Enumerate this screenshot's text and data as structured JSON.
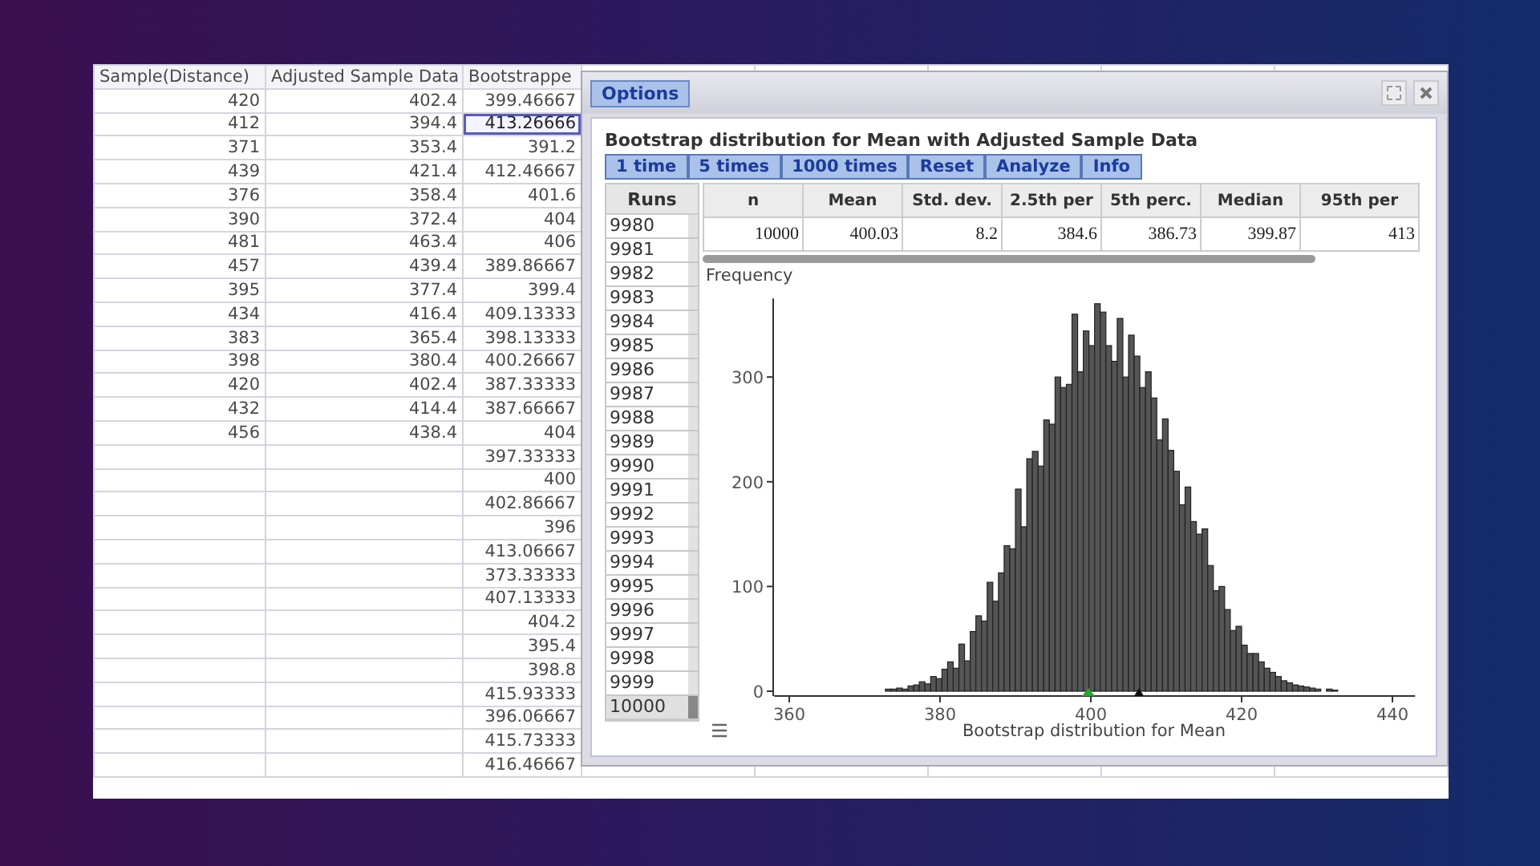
{
  "sheet": {
    "columns": [
      "Sample(Distance)",
      "Adjusted Sample Data",
      "Bootstrappe"
    ],
    "rows": [
      {
        "sample": "420",
        "adjusted": "402.4",
        "bootstrapped": "399.46667",
        "selected": false
      },
      {
        "sample": "412",
        "adjusted": "394.4",
        "bootstrapped": "413.26666",
        "selected": true
      },
      {
        "sample": "371",
        "adjusted": "353.4",
        "bootstrapped": "391.2",
        "selected": false
      },
      {
        "sample": "439",
        "adjusted": "421.4",
        "bootstrapped": "412.46667",
        "selected": false
      },
      {
        "sample": "376",
        "adjusted": "358.4",
        "bootstrapped": "401.6",
        "selected": false
      },
      {
        "sample": "390",
        "adjusted": "372.4",
        "bootstrapped": "404",
        "selected": false
      },
      {
        "sample": "481",
        "adjusted": "463.4",
        "bootstrapped": "406",
        "selected": false
      },
      {
        "sample": "457",
        "adjusted": "439.4",
        "bootstrapped": "389.86667",
        "selected": false
      },
      {
        "sample": "395",
        "adjusted": "377.4",
        "bootstrapped": "399.4",
        "selected": false
      },
      {
        "sample": "434",
        "adjusted": "416.4",
        "bootstrapped": "409.13333",
        "selected": false
      },
      {
        "sample": "383",
        "adjusted": "365.4",
        "bootstrapped": "398.13333",
        "selected": false
      },
      {
        "sample": "398",
        "adjusted": "380.4",
        "bootstrapped": "400.26667",
        "selected": false
      },
      {
        "sample": "420",
        "adjusted": "402.4",
        "bootstrapped": "387.33333",
        "selected": false
      },
      {
        "sample": "432",
        "adjusted": "414.4",
        "bootstrapped": "387.66667",
        "selected": false
      },
      {
        "sample": "456",
        "adjusted": "438.4",
        "bootstrapped": "404",
        "selected": false
      },
      {
        "bootstrapped": "397.33333",
        "selected": false
      },
      {
        "bootstrapped": "400",
        "selected": false
      },
      {
        "bootstrapped": "402.86667",
        "selected": false
      },
      {
        "bootstrapped": "396",
        "selected": false
      },
      {
        "bootstrapped": "413.06667",
        "selected": false
      },
      {
        "bootstrapped": "373.33333",
        "selected": false
      },
      {
        "bootstrapped": "407.13333",
        "selected": false
      },
      {
        "bootstrapped": "404.2",
        "selected": false
      },
      {
        "bootstrapped": "395.4",
        "selected": false
      },
      {
        "bootstrapped": "398.8",
        "selected": false
      },
      {
        "bootstrapped": "415.93333",
        "selected": false
      },
      {
        "bootstrapped": "396.06667",
        "selected": false
      },
      {
        "bootstrapped": "415.73333",
        "selected": false
      },
      {
        "bootstrapped": "416.46667",
        "selected": false
      }
    ]
  },
  "dialog": {
    "options_button": "Options",
    "title": "Bootstrap distribution for Mean with Adjusted Sample Data",
    "buttons": [
      "1 time",
      "5 times",
      "1000 times",
      "Reset",
      "Analyze",
      "Info"
    ],
    "runs": {
      "header": "Runs",
      "rows": [
        {
          "label": "9980",
          "selected": false
        },
        {
          "label": "9981",
          "selected": false
        },
        {
          "label": "9982",
          "selected": false
        },
        {
          "label": "9983",
          "selected": false
        },
        {
          "label": "9984",
          "selected": false
        },
        {
          "label": "9985",
          "selected": false
        },
        {
          "label": "9986",
          "selected": false
        },
        {
          "label": "9987",
          "selected": false
        },
        {
          "label": "9988",
          "selected": false
        },
        {
          "label": "9989",
          "selected": false
        },
        {
          "label": "9990",
          "selected": false
        },
        {
          "label": "9991",
          "selected": false
        },
        {
          "label": "9992",
          "selected": false
        },
        {
          "label": "9993",
          "selected": false
        },
        {
          "label": "9994",
          "selected": false
        },
        {
          "label": "9995",
          "selected": false
        },
        {
          "label": "9996",
          "selected": false
        },
        {
          "label": "9997",
          "selected": false
        },
        {
          "label": "9998",
          "selected": false
        },
        {
          "label": "9999",
          "selected": false
        },
        {
          "label": "10000",
          "selected": true
        }
      ]
    },
    "stats": {
      "columns": [
        "n",
        "Mean",
        "Std. dev.",
        "2.5th per",
        "5th perc.",
        "Median",
        "95th per"
      ],
      "values": [
        "10000",
        "400.03",
        "8.2",
        "384.6",
        "386.73",
        "399.87",
        "413"
      ]
    },
    "chart_data": {
      "type": "bar",
      "xlabel": "Bootstrap distribution for Mean",
      "ylabel": "Frequency",
      "x": [
        373.125,
        373.875,
        374.625,
        375.375,
        376.125,
        376.875,
        377.625,
        378.375,
        379.125,
        379.875,
        380.625,
        381.375,
        382.125,
        382.875,
        383.625,
        384.375,
        385.125,
        385.875,
        386.625,
        387.375,
        388.125,
        388.875,
        389.625,
        390.375,
        391.125,
        391.875,
        392.625,
        393.375,
        394.125,
        394.875,
        395.625,
        396.375,
        397.125,
        397.875,
        398.625,
        399.375,
        400.125,
        400.875,
        401.625,
        402.375,
        403.125,
        403.875,
        404.625,
        405.375,
        406.125,
        406.875,
        407.625,
        408.375,
        409.125,
        409.875,
        410.625,
        411.375,
        412.125,
        412.875,
        413.625,
        414.375,
        415.125,
        415.875,
        416.625,
        417.375,
        418.125,
        418.875,
        419.625,
        420.375,
        421.125,
        421.875,
        422.625,
        423.375,
        424.125,
        424.875,
        425.625,
        426.375,
        427.125,
        427.875,
        428.625,
        429.375,
        430.125,
        430.875,
        431.625,
        432.375
      ],
      "values": [
        2,
        2,
        3,
        2,
        5,
        6,
        9,
        7,
        14,
        12,
        21,
        28,
        22,
        45,
        29,
        57,
        72,
        67,
        104,
        86,
        113,
        139,
        136,
        193,
        157,
        222,
        229,
        215,
        259,
        255,
        300,
        290,
        293,
        360,
        305,
        344,
        330,
        370,
        362,
        330,
        315,
        356,
        300,
        340,
        320,
        290,
        305,
        280,
        240,
        260,
        230,
        210,
        178,
        195,
        162,
        150,
        155,
        120,
        96,
        100,
        78,
        58,
        62,
        44,
        36,
        36,
        28,
        22,
        18,
        14,
        10,
        8,
        6,
        5,
        4,
        3,
        2,
        0,
        2,
        1
      ],
      "xlim": [
        358,
        443
      ],
      "ylim": [
        0,
        375
      ],
      "xticks": [
        360,
        380,
        400,
        420,
        440
      ],
      "yticks": [
        0,
        100,
        200,
        300
      ]
    }
  }
}
